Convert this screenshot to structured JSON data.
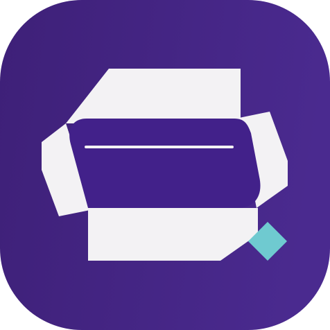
{
  "app_icon": {
    "icon": "unrolled-box-logo-icon",
    "colors": {
      "background_start": "#3e2078",
      "background_end": "#4a2a8f",
      "panel": "#f3f2f4",
      "screen": "#42218a",
      "screen_line": "#f3f2f4",
      "accent_diamond": "#6fcad0"
    }
  }
}
